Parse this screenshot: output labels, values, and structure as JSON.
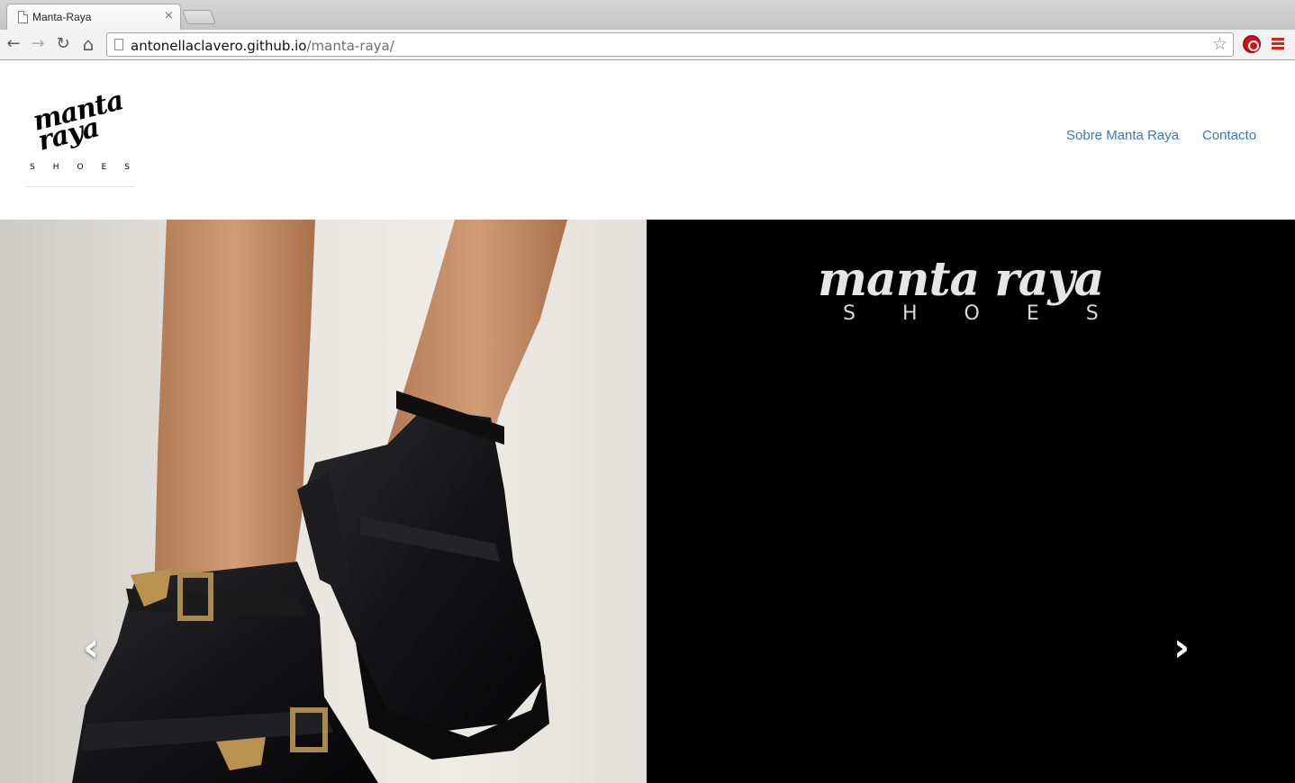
{
  "browser": {
    "tab_title": "Manta-Raya",
    "tab_close": "×",
    "url_host": "antonellaclavero.github.io",
    "url_path": "/manta-raya/",
    "icons": {
      "back": "←",
      "forward": "→",
      "reload": "↻",
      "home": "⌂",
      "bookmark": "☆"
    }
  },
  "site": {
    "logo": {
      "line1": "manta",
      "line2": "raya",
      "tagline": "SHOES"
    },
    "nav": [
      {
        "label": "Sobre Manta Raya"
      },
      {
        "label": "Contacto"
      }
    ]
  },
  "carousel": {
    "banner_script": "manta raya",
    "banner_tagline": "SHOES",
    "prev_glyph": "‹",
    "next_glyph": "›"
  }
}
